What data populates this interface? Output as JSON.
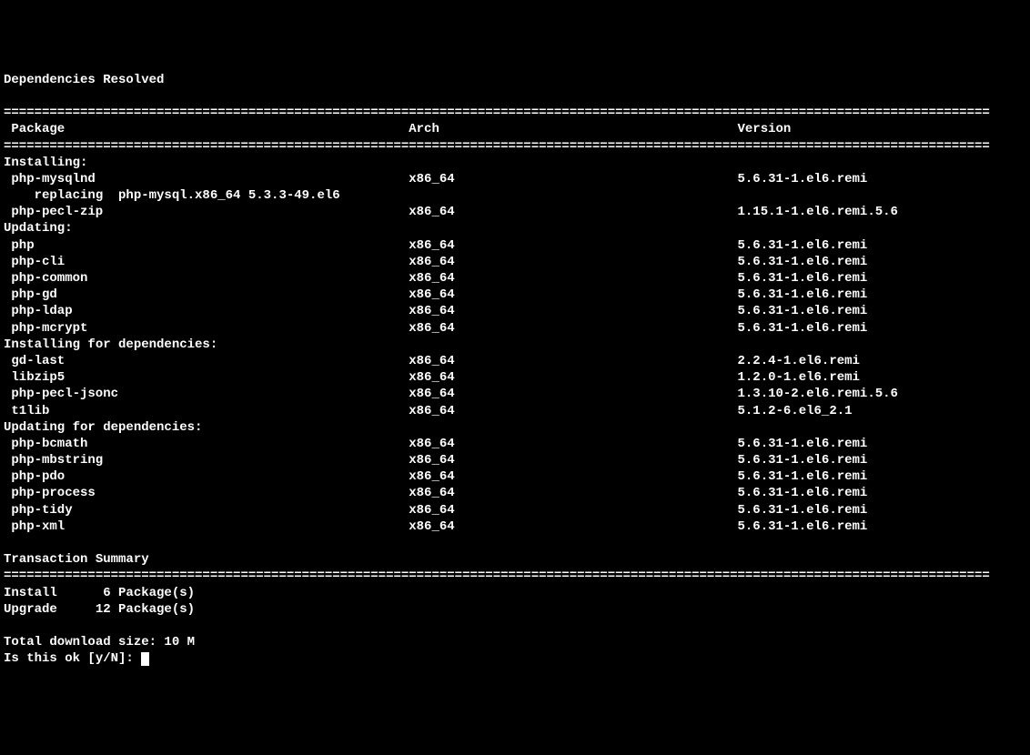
{
  "title": "Dependencies Resolved",
  "double_rule": "=================================================================================================================================",
  "headers": {
    "package": "Package",
    "arch": "Arch",
    "version": "Version"
  },
  "sections": [
    {
      "heading": "Installing:",
      "packages": [
        {
          "name": "php-mysqlnd",
          "arch": "x86_64",
          "version": "5.6.31-1.el6.remi",
          "note": "    replacing  php-mysql.x86_64 5.3.3-49.el6"
        },
        {
          "name": "php-pecl-zip",
          "arch": "x86_64",
          "version": "1.15.1-1.el6.remi.5.6"
        }
      ]
    },
    {
      "heading": "Updating:",
      "packages": [
        {
          "name": "php",
          "arch": "x86_64",
          "version": "5.6.31-1.el6.remi"
        },
        {
          "name": "php-cli",
          "arch": "x86_64",
          "version": "5.6.31-1.el6.remi"
        },
        {
          "name": "php-common",
          "arch": "x86_64",
          "version": "5.6.31-1.el6.remi"
        },
        {
          "name": "php-gd",
          "arch": "x86_64",
          "version": "5.6.31-1.el6.remi"
        },
        {
          "name": "php-ldap",
          "arch": "x86_64",
          "version": "5.6.31-1.el6.remi"
        },
        {
          "name": "php-mcrypt",
          "arch": "x86_64",
          "version": "5.6.31-1.el6.remi"
        }
      ]
    },
    {
      "heading": "Installing for dependencies:",
      "packages": [
        {
          "name": "gd-last",
          "arch": "x86_64",
          "version": "2.2.4-1.el6.remi"
        },
        {
          "name": "libzip5",
          "arch": "x86_64",
          "version": "1.2.0-1.el6.remi"
        },
        {
          "name": "php-pecl-jsonc",
          "arch": "x86_64",
          "version": "1.3.10-2.el6.remi.5.6"
        },
        {
          "name": "t1lib",
          "arch": "x86_64",
          "version": "5.1.2-6.el6_2.1"
        }
      ]
    },
    {
      "heading": "Updating for dependencies:",
      "packages": [
        {
          "name": "php-bcmath",
          "arch": "x86_64",
          "version": "5.6.31-1.el6.remi"
        },
        {
          "name": "php-mbstring",
          "arch": "x86_64",
          "version": "5.6.31-1.el6.remi"
        },
        {
          "name": "php-pdo",
          "arch": "x86_64",
          "version": "5.6.31-1.el6.remi"
        },
        {
          "name": "php-process",
          "arch": "x86_64",
          "version": "5.6.31-1.el6.remi"
        },
        {
          "name": "php-tidy",
          "arch": "x86_64",
          "version": "5.6.31-1.el6.remi"
        },
        {
          "name": "php-xml",
          "arch": "x86_64",
          "version": "5.6.31-1.el6.remi"
        }
      ]
    }
  ],
  "transaction_title": "Transaction Summary",
  "summary": {
    "install_label": "Install",
    "install_count": "6 Package(s)",
    "upgrade_label": "Upgrade",
    "upgrade_count": "12 Package(s)"
  },
  "download_size": "Total download size: 10 M",
  "prompt": "Is this ok [y/N]: "
}
